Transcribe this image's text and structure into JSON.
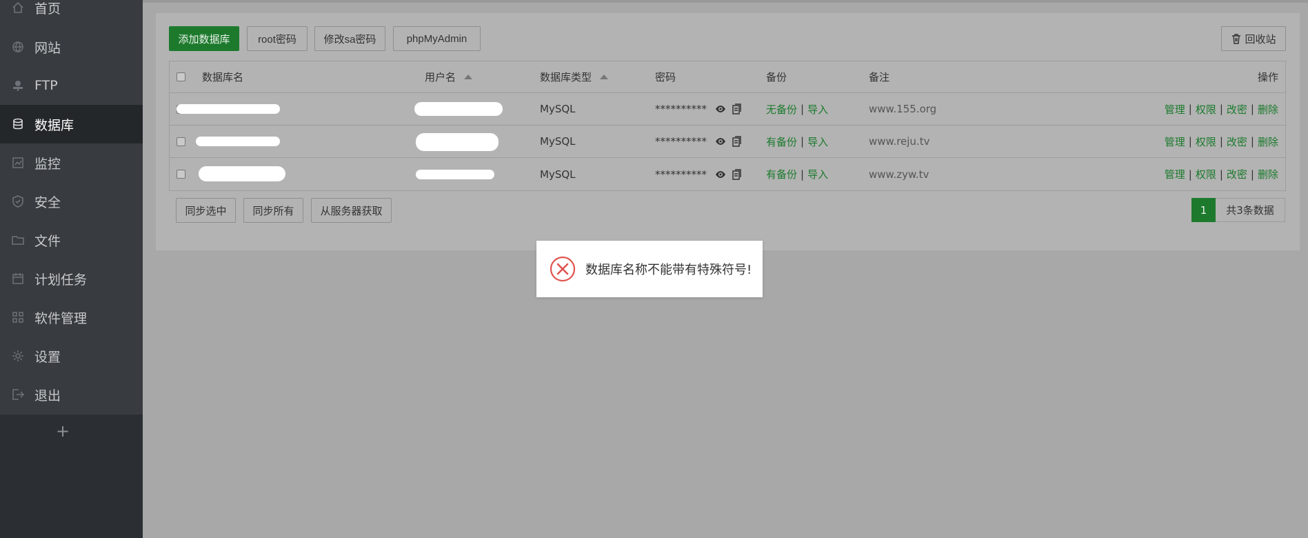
{
  "sidebar": {
    "items": [
      {
        "label": "首页",
        "icon": "home-icon"
      },
      {
        "label": "网站",
        "icon": "globe-icon"
      },
      {
        "label": "FTP",
        "icon": "ftp-icon"
      },
      {
        "label": "数据库",
        "icon": "database-icon",
        "active": true
      },
      {
        "label": "监控",
        "icon": "monitor-icon"
      },
      {
        "label": "安全",
        "icon": "shield-icon"
      },
      {
        "label": "文件",
        "icon": "folder-icon"
      },
      {
        "label": "计划任务",
        "icon": "calendar-icon"
      },
      {
        "label": "软件管理",
        "icon": "grid-icon"
      },
      {
        "label": "设置",
        "icon": "gear-icon"
      },
      {
        "label": "退出",
        "icon": "logout-icon"
      }
    ],
    "add_label": "+"
  },
  "toolbar": {
    "add_db": "添加数据库",
    "root_pwd": "root密码",
    "sa_pwd": "修改sa密码",
    "phpmyadmin": "phpMyAdmin",
    "recycle": "回收站"
  },
  "table": {
    "headers": {
      "name": "数据库名",
      "user": "用户名",
      "type": "数据库类型",
      "password": "密码",
      "backup": "备份",
      "note": "备注",
      "ops": "操作"
    },
    "rows": [
      {
        "type": "MySQL",
        "password": "**********",
        "backup": "无备份",
        "import": "导入",
        "note": "www.155.org"
      },
      {
        "type": "MySQL",
        "password": "**********",
        "backup": "有备份",
        "import": "导入",
        "note": "www.reju.tv"
      },
      {
        "type": "MySQL",
        "password": "**********",
        "backup": "有备份",
        "import": "导入",
        "note": "www.zyw.tv"
      }
    ],
    "ops": {
      "manage": "管理",
      "perm": "权限",
      "change_pwd": "改密",
      "delete": "删除"
    }
  },
  "footer": {
    "sync_selected": "同步选中",
    "sync_all": "同步所有",
    "fetch_server": "从服务器获取",
    "page": "1",
    "total": "共3条数据"
  },
  "toast": {
    "message": "数据库名称不能带有特殊符号!",
    "icon": "error-circle-icon",
    "color": "#e0534e"
  },
  "colors": {
    "accent": "#1d7a2d",
    "sidebar_bg": "#383c40",
    "overlay_bg": "#a8a8a8"
  }
}
